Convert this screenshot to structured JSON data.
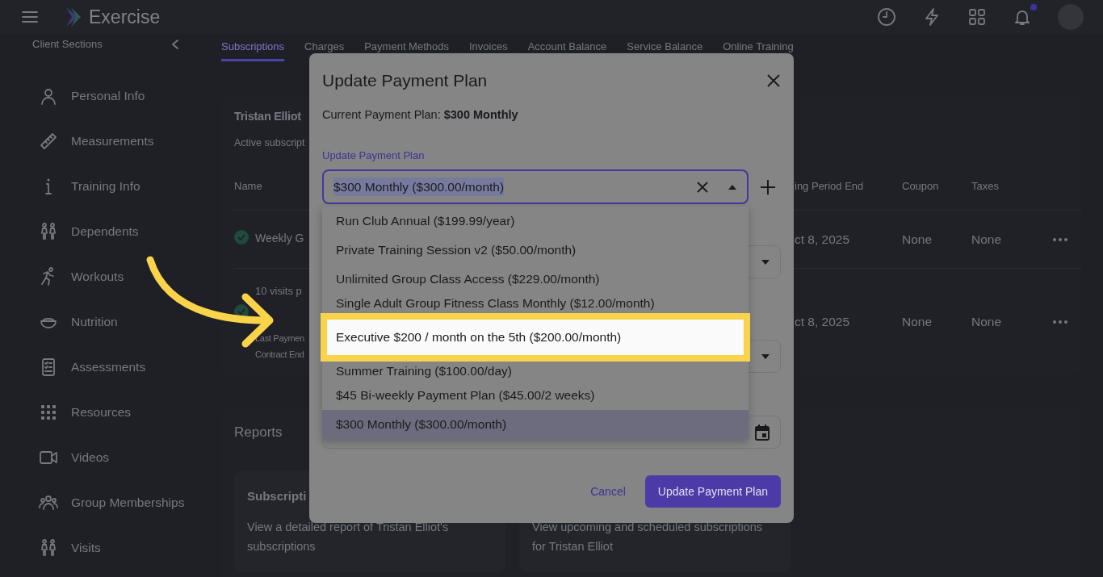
{
  "header": {
    "title": "Exercise",
    "notification_dot": true
  },
  "sidebar": {
    "title": "Client Sections",
    "items": [
      {
        "label": "Personal Info"
      },
      {
        "label": "Measurements"
      },
      {
        "label": "Training Info"
      },
      {
        "label": "Dependents"
      },
      {
        "label": "Workouts"
      },
      {
        "label": "Nutrition"
      },
      {
        "label": "Assessments"
      },
      {
        "label": "Resources"
      },
      {
        "label": "Videos"
      },
      {
        "label": "Group Memberships"
      },
      {
        "label": "Visits"
      }
    ]
  },
  "tabs": [
    {
      "label": "Subscriptions",
      "selected": true
    },
    {
      "label": "Charges",
      "selected": false
    },
    {
      "label": "Payment Methods",
      "selected": false
    },
    {
      "label": "Invoices",
      "selected": false
    },
    {
      "label": "Account Balance",
      "selected": false
    },
    {
      "label": "Service Balance",
      "selected": false
    },
    {
      "label": "Online Training",
      "selected": false
    }
  ],
  "subscriptions_card": {
    "title": "Tristan Elliot",
    "subtitle": "Active subscript",
    "columns": [
      "Name",
      "ing Period End",
      "Coupon",
      "Taxes"
    ],
    "rows": [
      {
        "name": "Weekly G",
        "active": true,
        "details": [],
        "period_end": "ct 8, 2025",
        "coupon": "None",
        "taxes": "None"
      },
      {
        "name": "10 visits p",
        "active": true,
        "details": [
          "Last Paymen",
          "Contract End"
        ],
        "period_end": "ct 8, 2025",
        "coupon": "None",
        "taxes": "None"
      }
    ]
  },
  "reports": {
    "title": "Reports",
    "cards": [
      {
        "title": "Subscripti",
        "description": "View a detailed report of Tristan Elliot's subscriptions"
      },
      {
        "description": "View upcoming and scheduled subscriptions for Tristan Elliot"
      }
    ]
  },
  "modal": {
    "title": "Update Payment Plan",
    "current": "Current Payment Plan: **$300 Monthly**",
    "field_label": "Update Payment Plan",
    "value": "$300 Monthly ($300.00/month)",
    "value_selected": true,
    "dropdown_open": true,
    "options": [
      {
        "label": "Run Club Annual ($199.99/year)",
        "selected": false,
        "highlighted": false
      },
      {
        "label": "Private Training Session v2 ($50.00/month)",
        "selected": false,
        "highlighted": false
      },
      {
        "label": "Unlimited Group Class Access ($229.00/month)",
        "selected": false,
        "highlighted": false
      },
      {
        "label": "Single Adult Group Fitness Class Monthly ($12.00/month)",
        "selected": false,
        "highlighted": false
      },
      {
        "label": "Executive $200 / month on the 5th ($200.00/month)",
        "selected": false,
        "highlighted": true
      },
      {
        "label": "Summer Training ($100.00/day)",
        "selected": false,
        "highlighted": false
      },
      {
        "label": "$45 Bi-weekly Payment Plan ($45.00/2 weeks)",
        "selected": false,
        "highlighted": false
      },
      {
        "label": "$300 Monthly ($300.00/month)",
        "selected": true,
        "highlighted": false
      }
    ],
    "buttons": [
      {
        "label": "Cancel",
        "kind": "link"
      },
      {
        "label": "Update Payment Plan",
        "kind": "primary"
      }
    ]
  }
}
